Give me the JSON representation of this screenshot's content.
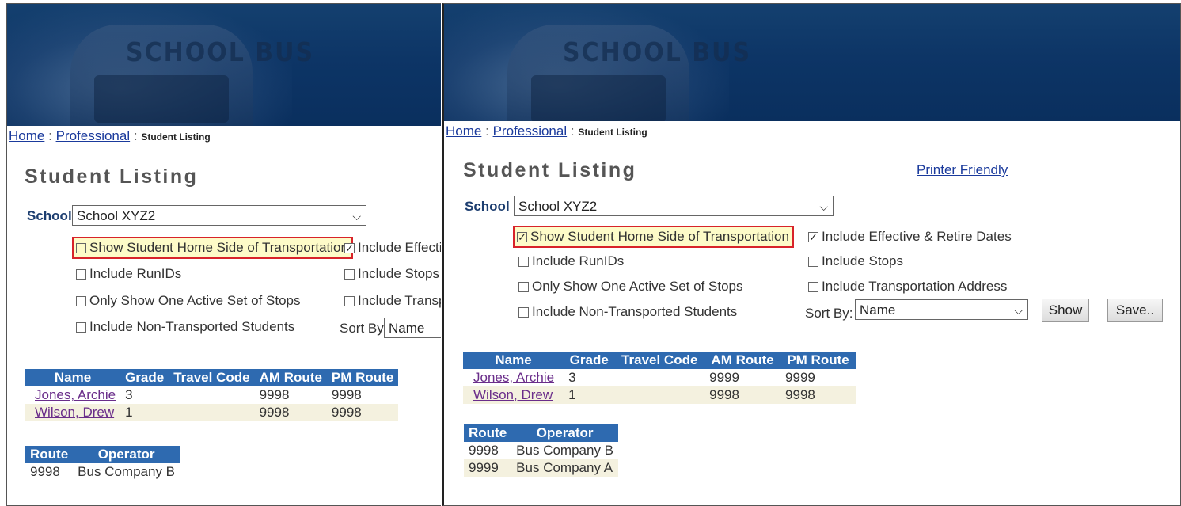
{
  "left": {
    "banner_text": "SCHOOL BUS",
    "breadcrumb": {
      "home": "Home",
      "sep1": ":",
      "professional": "Professional",
      "sep2": ":",
      "current": "Student Listing"
    },
    "title": "Student Listing",
    "school_label": "School",
    "school_value": "School XYZ2",
    "options": {
      "home_side": {
        "label": "Show Student Home Side of Transportation",
        "checked": false
      },
      "runids": {
        "label": "Include RunIDs",
        "checked": false
      },
      "one_active": {
        "label": "Only Show One Active Set of Stops",
        "checked": false
      },
      "non_transported": {
        "label": "Include Non-Transported Students",
        "checked": false
      },
      "effective": {
        "label": "Include Effectiv",
        "checked": true
      },
      "stops": {
        "label": "Include Stops",
        "checked": false
      },
      "transport": {
        "label": "Include Transpo",
        "checked": false
      }
    },
    "sort_label": "Sort By:",
    "sort_value": "Name",
    "students": {
      "headers": [
        "Name",
        "Grade",
        "Travel Code",
        "AM Route",
        "PM Route"
      ],
      "rows": [
        {
          "name": "Jones, Archie",
          "grade": "3",
          "travel": "",
          "am": "9998",
          "pm": "9998"
        },
        {
          "name": "Wilson, Drew",
          "grade": "1",
          "travel": "",
          "am": "9998",
          "pm": "9998"
        }
      ]
    },
    "routes": {
      "headers": [
        "Route",
        "Operator"
      ],
      "rows": [
        {
          "route": "9998",
          "operator": "Bus Company B"
        }
      ]
    }
  },
  "right": {
    "banner_text": "SCHOOL BUS",
    "breadcrumb": {
      "home": "Home",
      "sep1": ":",
      "professional": "Professional",
      "sep2": ":",
      "current": "Student Listing"
    },
    "title": "Student Listing",
    "printer_friendly": "Printer Friendly",
    "school_label": "School",
    "school_value": "School XYZ2",
    "options": {
      "home_side": {
        "label": "Show Student Home Side of Transportation",
        "checked": true
      },
      "runids": {
        "label": "Include RunIDs",
        "checked": false
      },
      "one_active": {
        "label": "Only Show One Active Set of Stops",
        "checked": false
      },
      "non_transported": {
        "label": "Include Non-Transported Students",
        "checked": false
      },
      "effective": {
        "label": "Include Effective & Retire Dates",
        "checked": true
      },
      "stops": {
        "label": "Include Stops",
        "checked": false
      },
      "transport": {
        "label": "Include Transportation Address",
        "checked": false
      }
    },
    "sort_label": "Sort By:",
    "sort_value": "Name",
    "show_button": "Show",
    "save_button": "Save..",
    "students": {
      "headers": [
        "Name",
        "Grade",
        "Travel Code",
        "AM Route",
        "PM Route"
      ],
      "rows": [
        {
          "name": "Jones, Archie",
          "grade": "3",
          "travel": "",
          "am": "9999",
          "pm": "9999"
        },
        {
          "name": "Wilson, Drew",
          "grade": "1",
          "travel": "",
          "am": "9998",
          "pm": "9998"
        }
      ]
    },
    "routes": {
      "headers": [
        "Route",
        "Operator"
      ],
      "rows": [
        {
          "route": "9998",
          "operator": "Bus Company B"
        },
        {
          "route": "9999",
          "operator": "Bus Company A"
        }
      ]
    }
  },
  "colors": {
    "banner": "#0d3566",
    "table_header": "#2e6ab0",
    "highlight_border": "#d8232a",
    "highlight_fill": "#fdfbc8",
    "link": "#1a3a9c",
    "visited_link": "#6a2d8a"
  }
}
